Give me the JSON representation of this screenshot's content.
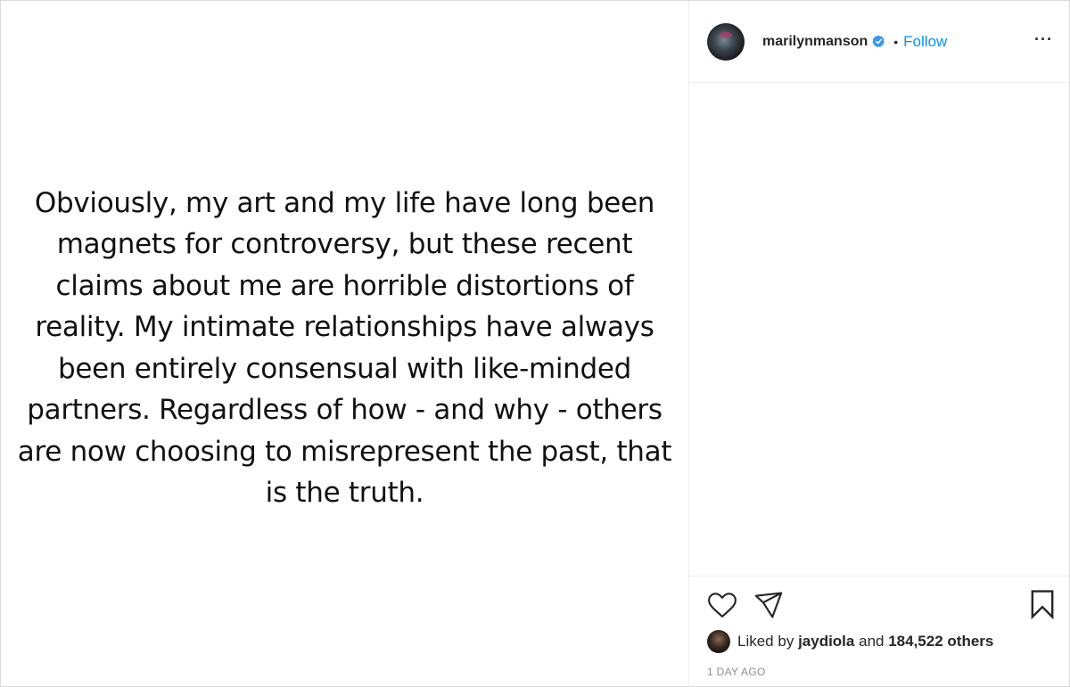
{
  "post": {
    "text": "Obviously, my art and my life have long been\nmagnets for controversy, but these recent\nclaims about me are horrible distortions of\nreality. My intimate relationships have always\nbeen entirely consensual with like-minded\npartners. Regardless of how - and why - others\nare now choosing to misrepresent the past, that\nis the truth."
  },
  "header": {
    "username": "marilynmanson",
    "separator": "•",
    "follow_label": "Follow",
    "more_label": "···",
    "avatar_icon": "profile-avatar",
    "verified_icon": "verified-badge-icon",
    "verified_color": "#3897f0"
  },
  "actions": {
    "like_icon": "heart-icon",
    "share_icon": "paper-plane-icon",
    "save_icon": "bookmark-icon"
  },
  "likes": {
    "prefix": "Liked by",
    "user": "jaydiola",
    "and": "and",
    "others": "184,522 others"
  },
  "timestamp": "1 DAY AGO",
  "colors": {
    "accent": "#0095f6",
    "text": "#262626",
    "muted": "#8e8e8e",
    "border": "#dbdbdb"
  }
}
